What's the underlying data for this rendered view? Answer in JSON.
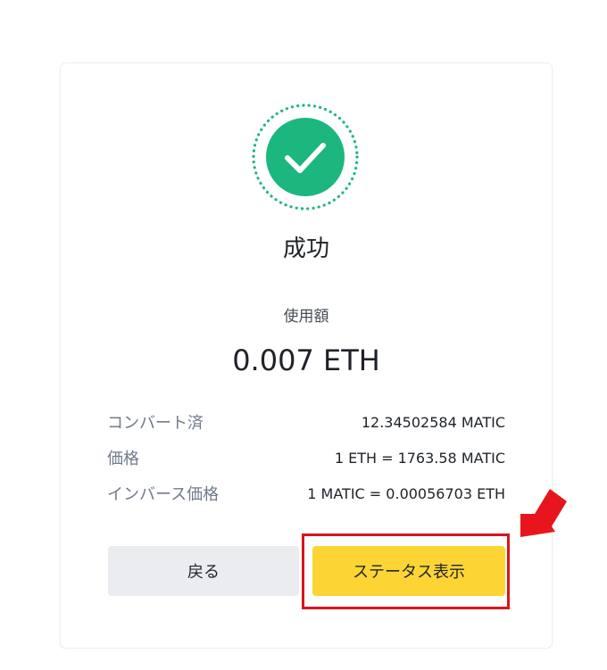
{
  "dialog": {
    "title": "成功",
    "amount_label": "使用額",
    "amount_value": "0.007 ETH",
    "details": [
      {
        "label": "コンバート済",
        "value": "12.34502584 MATIC"
      },
      {
        "label": "価格",
        "value": "1 ETH = 1763.58 MATIC"
      },
      {
        "label": "インバース価格",
        "value": "1 MATIC = 0.00056703 ETH"
      }
    ],
    "buttons": {
      "back_label": "戻る",
      "status_label": "ステータス表示"
    }
  },
  "icons": {
    "success": "check-circle-icon",
    "annotation": "red-arrow-icon"
  },
  "colors": {
    "success_green": "#1bb77f",
    "primary_yellow": "#fcd535",
    "secondary_gray": "#eaecef",
    "annotation_red": "#d9141c"
  }
}
